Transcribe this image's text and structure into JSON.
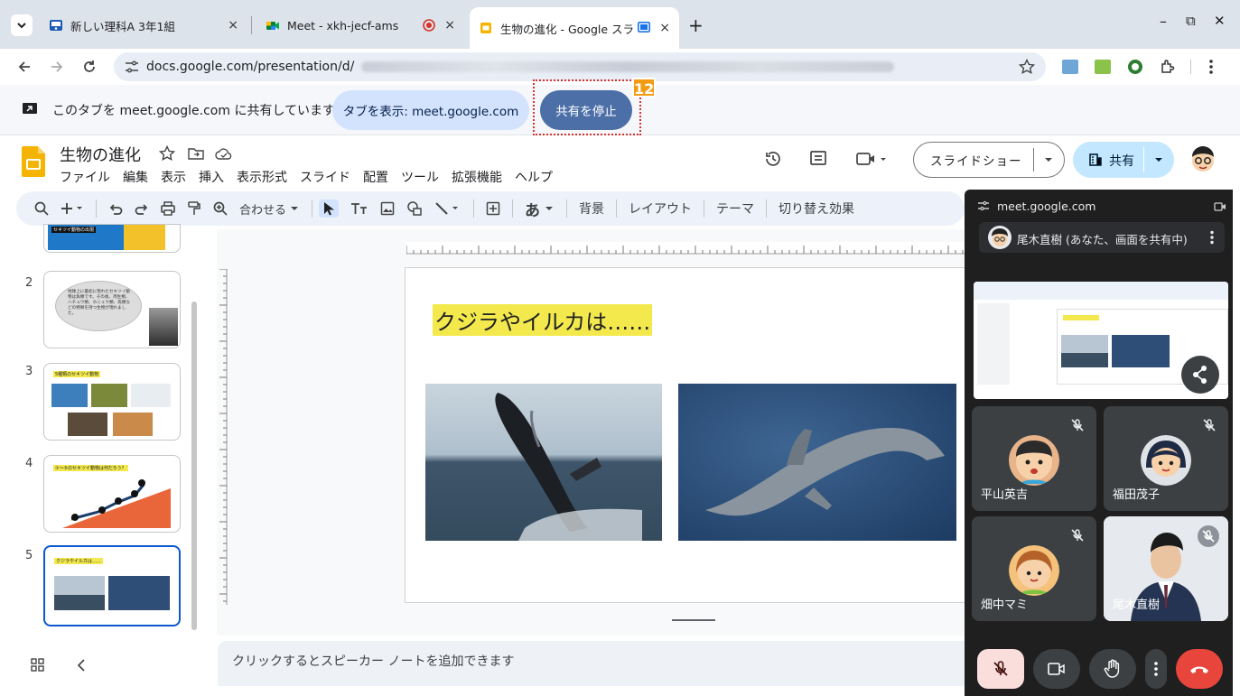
{
  "browser": {
    "tabs": [
      {
        "title": "新しい理科A 3年1組",
        "close": "×"
      },
      {
        "title": "Meet - xkh-jecf-ams",
        "close": "×"
      },
      {
        "title": "生物の進化 - Google スラ",
        "close": "×"
      }
    ],
    "new_tab": "+",
    "window_controls": {
      "minimize": "–",
      "restore": "⧉",
      "close": "✕"
    },
    "url": "docs.google.com/presentation/d/"
  },
  "share_banner": {
    "text": "このタブを meet.google.com に共有しています",
    "show_tab_button": "タブを表示: meet.google.com",
    "stop_button": "共有を停止",
    "callout_number": "12"
  },
  "docs": {
    "title": "生物の進化",
    "menu": [
      "ファイル",
      "編集",
      "表示",
      "挿入",
      "表示形式",
      "スライド",
      "配置",
      "ツール",
      "拡張機能",
      "ヘルプ"
    ],
    "slideshow_button": "スライドショー",
    "share_button": "共有",
    "toolbar": {
      "zoom": "合わせる",
      "aa": "あ",
      "background": "背景",
      "layout": "レイアウト",
      "theme": "テーマ",
      "transition": "切り替え効果"
    },
    "slide_numbers": [
      "2",
      "3",
      "4",
      "5"
    ],
    "thumbnails": {
      "t1_label": "セキツイ動物の出現",
      "t2_text": "地球上に最初に現れたセキツイ動物は魚類です。その後、両生類、ハチュウ類、ホニュウ類、鳥類などの特徴を持つ生物が現れました。",
      "t3_label": "5種類のセキツイ動物",
      "t4_label": "①〜⑤のセキツイ動物は何だろう？",
      "t5_label": "クジラやイルカは……"
    },
    "slide": {
      "heading": "クジラやイルカは……"
    },
    "speaker_notes": "クリックするとスピーカー ノートを追加できます"
  },
  "meet": {
    "site": "meet.google.com",
    "presenter": "尾木直樹 (あなた、画面を共有中)",
    "participants": [
      {
        "name": "平山英吉"
      },
      {
        "name": "福田茂子"
      },
      {
        "name": "畑中マミ"
      },
      {
        "name": "尾木直樹"
      }
    ]
  },
  "colors": {
    "accent": "#0b57d0",
    "stop_share": "#4c6fa8",
    "highlight": "#f3e94d",
    "callout": "#f39c12",
    "hangup": "#e8453c",
    "mic_off_bg": "#f9dedc"
  }
}
